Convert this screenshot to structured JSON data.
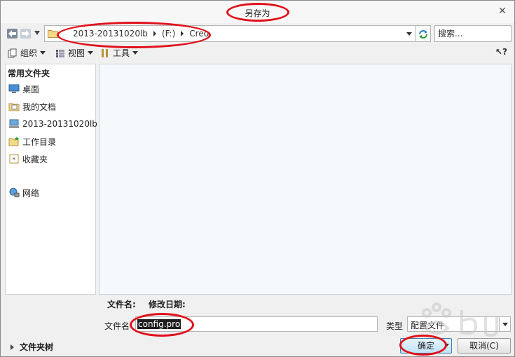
{
  "window": {
    "title": "另存为"
  },
  "nav": {
    "breadcrumbs": [
      "2013-20131020lb",
      "(F:)",
      "Creo"
    ]
  },
  "search": {
    "placeholder": "搜索..."
  },
  "toolbar": {
    "organize_label": "组织",
    "view_label": "视图",
    "tools_label": "工具"
  },
  "sidebar": {
    "header": "常用文件夹",
    "items": [
      {
        "label": "桌面",
        "icon": "desktop-icon"
      },
      {
        "label": "我的文档",
        "icon": "documents-icon"
      },
      {
        "label": "2013-20131020lb",
        "icon": "computer-icon"
      },
      {
        "label": "工作目录",
        "icon": "work-folder-icon"
      },
      {
        "label": "收藏夹",
        "icon": "favorites-icon"
      },
      {
        "label": "网络",
        "icon": "network-icon"
      }
    ]
  },
  "details": {
    "filename_header": "文件名:",
    "modified_header": "修改日期:"
  },
  "form": {
    "filename_label": "文件名",
    "filename_value": "config.pro",
    "type_label": "类型",
    "type_value": "配置文件"
  },
  "footer": {
    "folder_tree_label": "文件夹树",
    "ok_label": "确定",
    "cancel_label": "取消(C)"
  },
  "colors": {
    "highlight": "#e0101a",
    "filelist_bg": "#f5f9fc",
    "ok_accent": "#bfe2f7"
  }
}
